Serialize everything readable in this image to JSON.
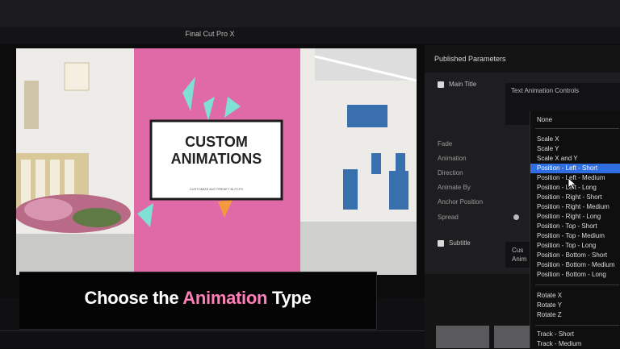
{
  "app": {
    "title": "Final Cut Pro X"
  },
  "preview": {
    "card_title_line1": "CUSTOM",
    "card_title_line2": "ANIMATIONS",
    "card_subtitle": "CUSTOMIZE ANY PRESET IN FCPX",
    "colors": {
      "pink": "#e06aa8",
      "mint": "#7fe0d3",
      "orange": "#f39a3e",
      "dark": "#222"
    }
  },
  "inspector": {
    "header": "Published Parameters",
    "main_title": "Main Title",
    "text_animation_controls": "Text Animation Controls",
    "params": [
      "Fade",
      "Animation",
      "Direction",
      "Animate By",
      "Anchor Position",
      "Spread"
    ],
    "subtitle": "Subtitle",
    "partial_box": [
      "Cus",
      "Anim"
    ]
  },
  "animation_menu": {
    "group1": [
      "None"
    ],
    "group2": [
      "Scale X",
      "Scale Y",
      "Scale X and Y",
      "Position - Left - Short",
      "Position - Left - Medium",
      "Position - Left - Long",
      "Position - Right - Short",
      "Position - Right - Medium",
      "Position - Right - Long",
      "Position - Top - Short",
      "Position - Top - Medium",
      "Position - Top - Long",
      "Position - Bottom - Short",
      "Position - Bottom - Medium",
      "Position - Bottom - Long"
    ],
    "group3": [
      "Rotate X",
      "Rotate Y",
      "Rotate Z"
    ],
    "group4": [
      "Track - Short",
      "Track - Medium"
    ],
    "selected": "Position - Left - Short",
    "accent": "#2f6ee0"
  },
  "caption": {
    "before": "Choose the ",
    "highlight": "Animation",
    "after": " Type",
    "highlight_color": "#ff7fb8"
  }
}
